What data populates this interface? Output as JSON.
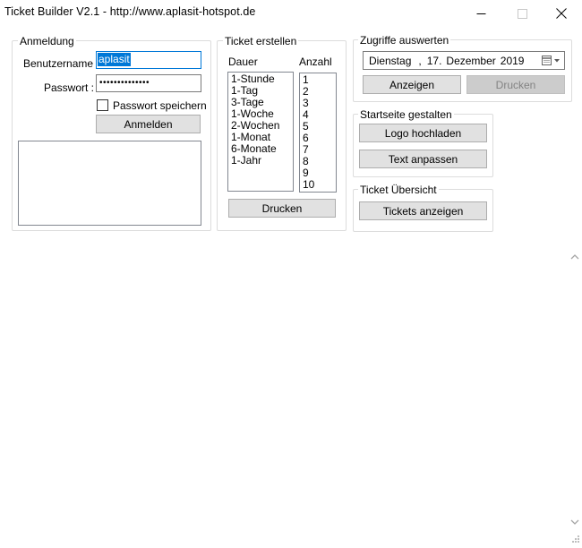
{
  "window": {
    "title": "Ticket Builder V2.1 - http://www.aplasit-hotspot.de"
  },
  "login": {
    "legend": "Anmeldung",
    "username_label": "Benutzername :",
    "username_value": "aplasit",
    "password_label": "Passwort :",
    "password_value": "••••••••••••••",
    "remember_label": "Passwort speichern",
    "remember_checked": false,
    "login_button": "Anmelden"
  },
  "ticket": {
    "legend": "Ticket erstellen",
    "duration_label": "Dauer",
    "count_label": "Anzahl",
    "durations": [
      "1-Stunde",
      "1-Tag",
      "3-Tage",
      "1-Woche",
      "2-Wochen",
      "1-Monat",
      "6-Monate",
      "1-Jahr"
    ],
    "counts": [
      "1",
      "2",
      "3",
      "4",
      "5",
      "6",
      "7",
      "8",
      "9",
      "10"
    ],
    "print_button": "Drucken"
  },
  "access": {
    "legend": "Zugriffe auswerten",
    "date_weekday": "Dienstag",
    "date_sep": ",",
    "date_day": "17.",
    "date_month": "Dezember",
    "date_year": "2019",
    "show_button": "Anzeigen",
    "print_button": "Drucken"
  },
  "homepage": {
    "legend": "Startseite gestalten",
    "upload_logo_button": "Logo hochladen",
    "edit_text_button": "Text anpassen"
  },
  "overview": {
    "legend": "Ticket Übersicht",
    "show_tickets_button": "Tickets anzeigen"
  }
}
